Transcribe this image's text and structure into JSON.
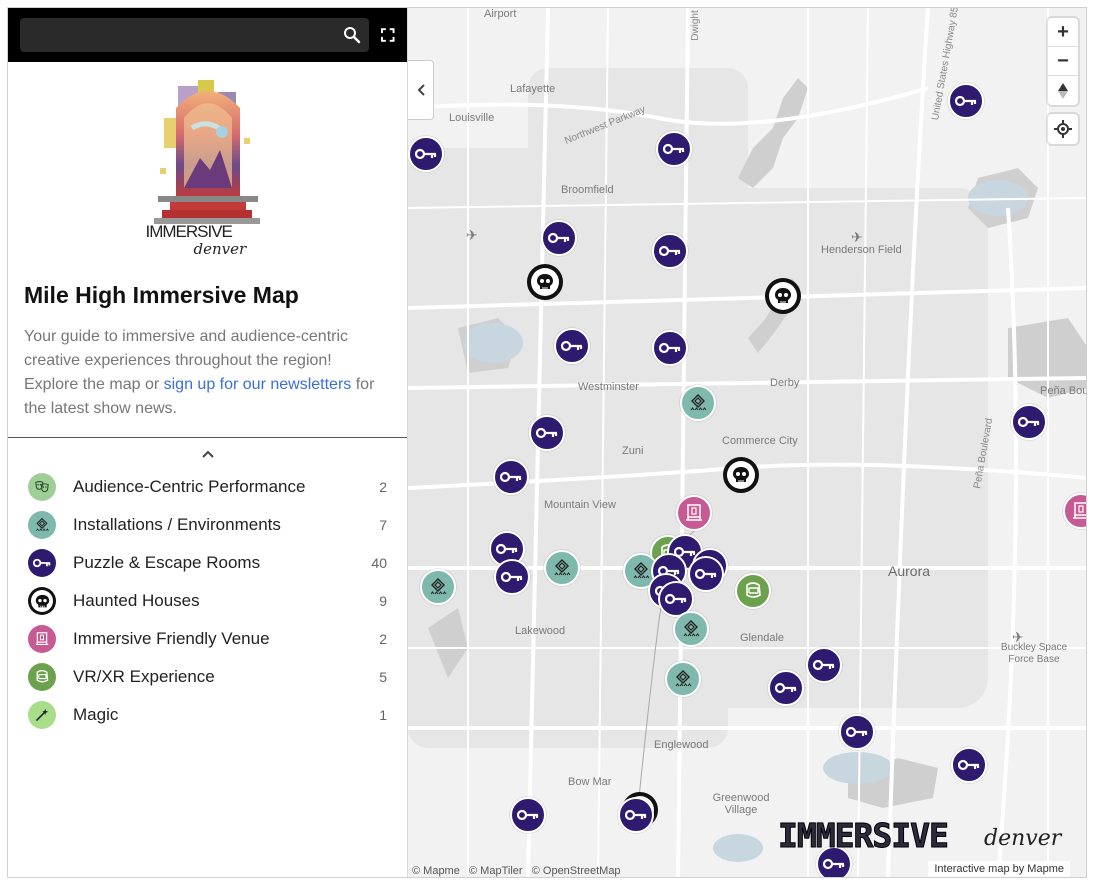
{
  "search": {
    "placeholder": "",
    "value": ""
  },
  "sidebar": {
    "logo_text_1": "IMMERSIVE",
    "logo_text_2": "denver",
    "title": "Mile High Immersive Map",
    "desc_part1": "Your guide to immersive and audience-centric creative experiences throughout the region! Explore the map or ",
    "desc_link": "sign up for our newsletters",
    "desc_part2": " for the latest show news."
  },
  "legend": [
    {
      "label": "Audience-Centric Performance",
      "count": "2",
      "color": "#9fcf96",
      "icon": "theater-masks-icon"
    },
    {
      "label": "Installations / Environments",
      "count": "7",
      "color": "#7fb9ad",
      "icon": "installation-icon"
    },
    {
      "label": "Puzzle & Escape Rooms",
      "count": "40",
      "color": "#2e1a6e",
      "icon": "key-icon"
    },
    {
      "label": "Haunted Houses",
      "count": "9",
      "color": "#111111",
      "icon": "skull-icon"
    },
    {
      "label": "Immersive Friendly Venue",
      "count": "2",
      "color": "#c75a93",
      "icon": "venue-icon"
    },
    {
      "label": "VR/XR Experience",
      "count": "5",
      "color": "#6ca24d",
      "icon": "vr-headset-icon"
    },
    {
      "label": "Magic",
      "count": "1",
      "color": "#a8dd8a",
      "icon": "magic-wand-icon"
    }
  ],
  "map": {
    "places": [
      "Airport",
      "Lafayette",
      "Louisville",
      "Northwest Parkway",
      "Broomfield",
      "Henderson Field",
      "Westminster",
      "Derby",
      "Commerce City",
      "Zuni",
      "Mountain View",
      "Aurora",
      "Lakewood",
      "Glendale",
      "Buckley Space Force Base",
      "Englewood",
      "Bow Mar",
      "Greenwood Village",
      "Peña Bou",
      "Peña Boulevard",
      "United States Highway 85",
      "Dwight"
    ],
    "attribution": [
      "© Mapme",
      "© MapTiler",
      "© OpenStreetMap"
    ],
    "credit": "Interactive map by Mapme",
    "wordmark_1": "IMMERSIVE",
    "wordmark_2": "denver",
    "zoom_in": "+",
    "zoom_out": "−"
  }
}
